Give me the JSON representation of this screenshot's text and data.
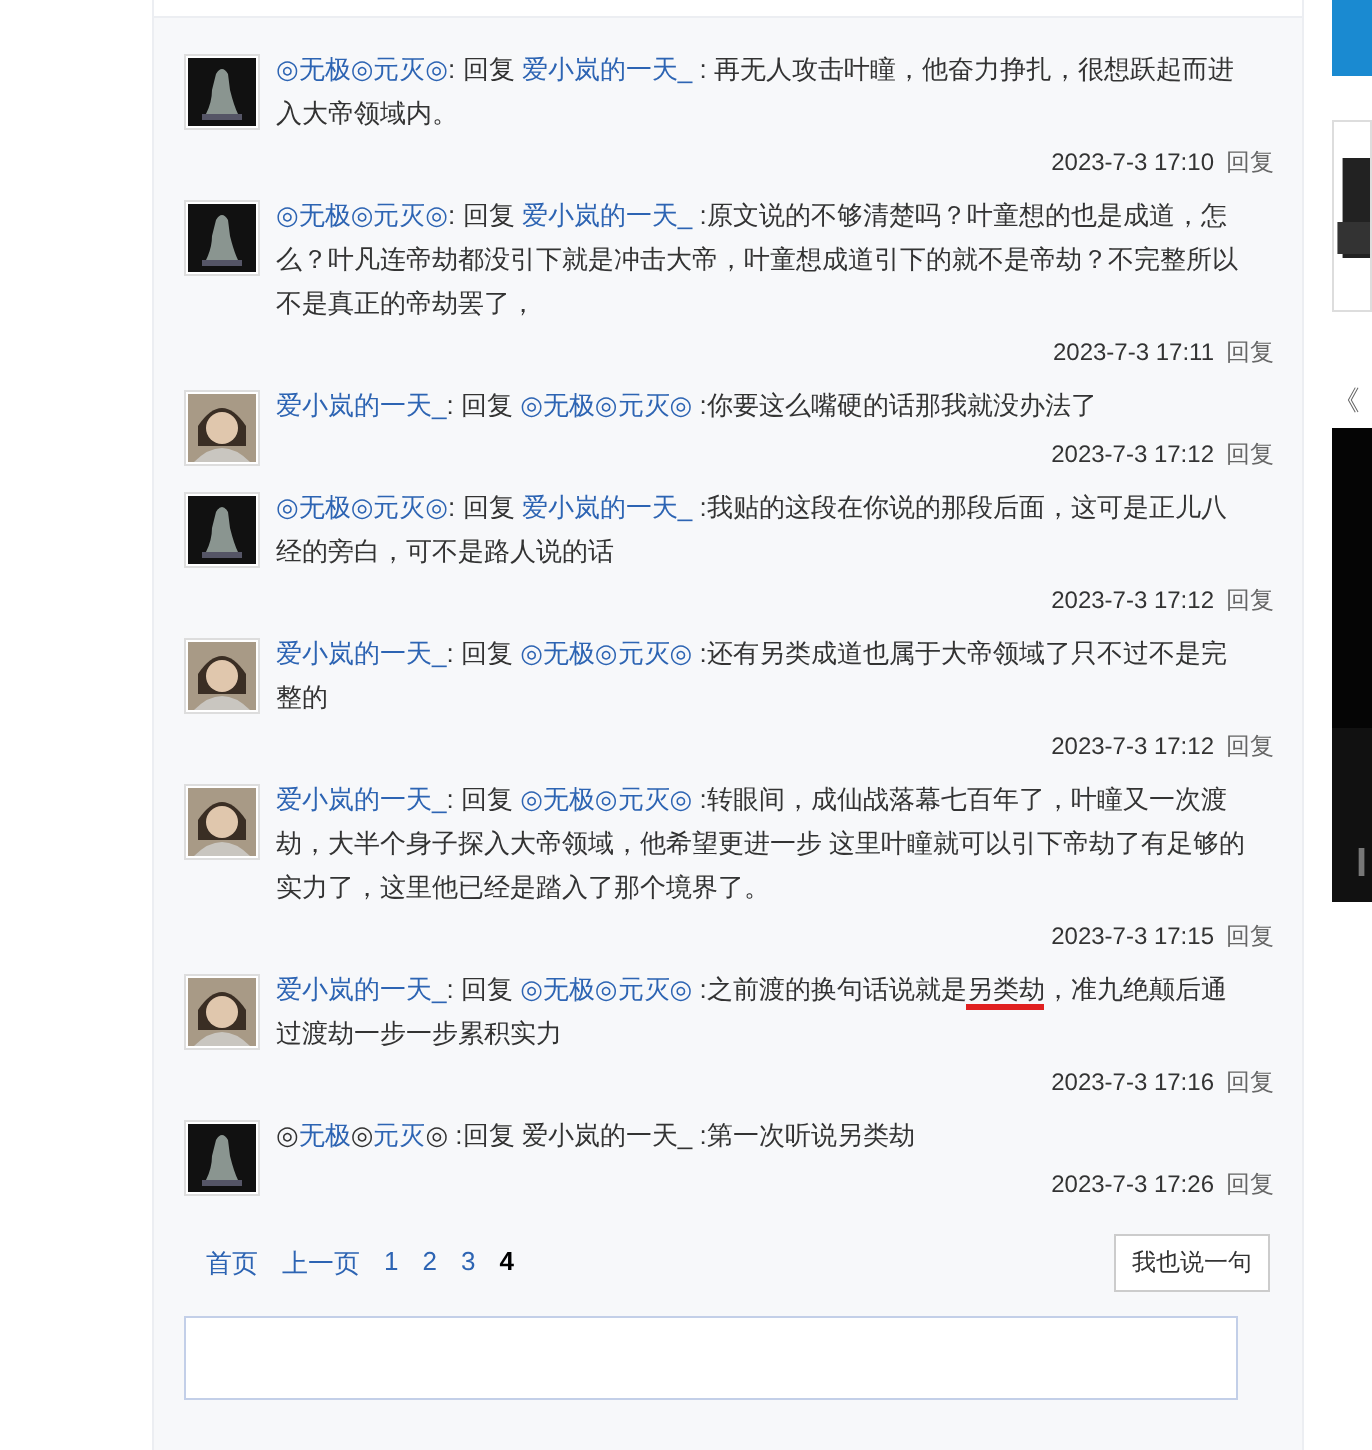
{
  "comments": [
    {
      "kind": "statue",
      "segments": [
        {
          "kind": "link",
          "text": "◎无极◎元灭◎"
        },
        {
          "kind": "plain",
          "text": ": 回复 "
        },
        {
          "kind": "link",
          "text": "爱小岚的一天_"
        },
        {
          "kind": "plain",
          "text": " : 再无人攻击叶瞳，他奋力挣扎，很想跃起而进入大帝领域内。"
        }
      ],
      "time": "2023-7-3 17:10",
      "reply": "回复"
    },
    {
      "kind": "statue",
      "segments": [
        {
          "kind": "link",
          "text": "◎无极◎元灭◎"
        },
        {
          "kind": "plain",
          "text": ": 回复 "
        },
        {
          "kind": "link",
          "text": "爱小岚的一天_"
        },
        {
          "kind": "plain",
          "text": " :原文说的不够清楚吗？叶童想的也是成道，怎么？叶凡连帝劫都没引下就是冲击大帝，叶童想成道引下的就不是帝劫？不完整所以不是真正的帝劫罢了，"
        }
      ],
      "time": "2023-7-3 17:11",
      "reply": "回复"
    },
    {
      "kind": "child",
      "segments": [
        {
          "kind": "link",
          "text": "爱小岚的一天_"
        },
        {
          "kind": "plain",
          "text": ": 回复 "
        },
        {
          "kind": "link",
          "text": "◎无极◎元灭◎"
        },
        {
          "kind": "plain",
          "text": " :你要这么嘴硬的话那我就没办法了"
        }
      ],
      "time": "2023-7-3 17:12",
      "reply": "回复"
    },
    {
      "kind": "statue",
      "segments": [
        {
          "kind": "link",
          "text": "◎无极◎元灭◎"
        },
        {
          "kind": "plain",
          "text": ": 回复 "
        },
        {
          "kind": "link",
          "text": "爱小岚的一天_"
        },
        {
          "kind": "plain",
          "text": " :我贴的这段在你说的那段后面，这可是正儿八经的旁白，可不是路人说的话"
        }
      ],
      "time": "2023-7-3 17:12",
      "reply": "回复"
    },
    {
      "kind": "child",
      "segments": [
        {
          "kind": "link",
          "text": "爱小岚的一天_"
        },
        {
          "kind": "plain",
          "text": ": 回复 "
        },
        {
          "kind": "link",
          "text": "◎无极◎元灭◎"
        },
        {
          "kind": "plain",
          "text": " :还有另类成道也属于大帝领域了只不过不是完整的"
        }
      ],
      "time": "2023-7-3 17:12",
      "reply": "回复"
    },
    {
      "kind": "child",
      "segments": [
        {
          "kind": "link",
          "text": "爱小岚的一天_"
        },
        {
          "kind": "plain",
          "text": ": 回复 "
        },
        {
          "kind": "link",
          "text": "◎无极◎元灭◎"
        },
        {
          "kind": "plain",
          "text": " :转眼间，成仙战落幕七百年了，叶瞳又一次渡劫，大半个身子探入大帝领域，他希望更进一步 这里叶瞳就可以引下帝劫了有足够的实力了，这里他已经是踏入了那个境界了。"
        }
      ],
      "time": "2023-7-3 17:15",
      "reply": "回复"
    },
    {
      "kind": "child",
      "segments": [
        {
          "kind": "link",
          "text": "爱小岚的一天_"
        },
        {
          "kind": "plain",
          "text": ": 回复 "
        },
        {
          "kind": "link",
          "text": "◎无极◎元灭◎"
        },
        {
          "kind": "plain",
          "text": " :之前渡的换句话说就是"
        },
        {
          "kind": "marked",
          "text": "另类劫"
        },
        {
          "kind": "plain",
          "text": "，准九绝颠后通过渡劫一步一步累积实力"
        }
      ],
      "time": "2023-7-3 17:16",
      "reply": "回复"
    },
    {
      "kind": "statue",
      "segments": [
        {
          "kind": "plain",
          "text": "◎"
        },
        {
          "kind": "link",
          "text": "无极"
        },
        {
          "kind": "plain",
          "text": "◎"
        },
        {
          "kind": "link",
          "text": "元灭"
        },
        {
          "kind": "plain",
          "text": "◎ :回复 爱小岚的一天_ :第一次听说另类劫"
        }
      ],
      "time": "2023-7-3 17:26",
      "reply": "回复"
    }
  ],
  "pagination": [
    {
      "label": "首页",
      "selected": false
    },
    {
      "label": "上一页",
      "selected": false
    },
    {
      "label": "1",
      "selected": false
    },
    {
      "label": "2",
      "selected": false
    },
    {
      "label": "3",
      "selected": false
    },
    {
      "label": "4",
      "selected": true
    }
  ],
  "reply_button": "我也说一句",
  "sidebar": {
    "mark": "《"
  }
}
